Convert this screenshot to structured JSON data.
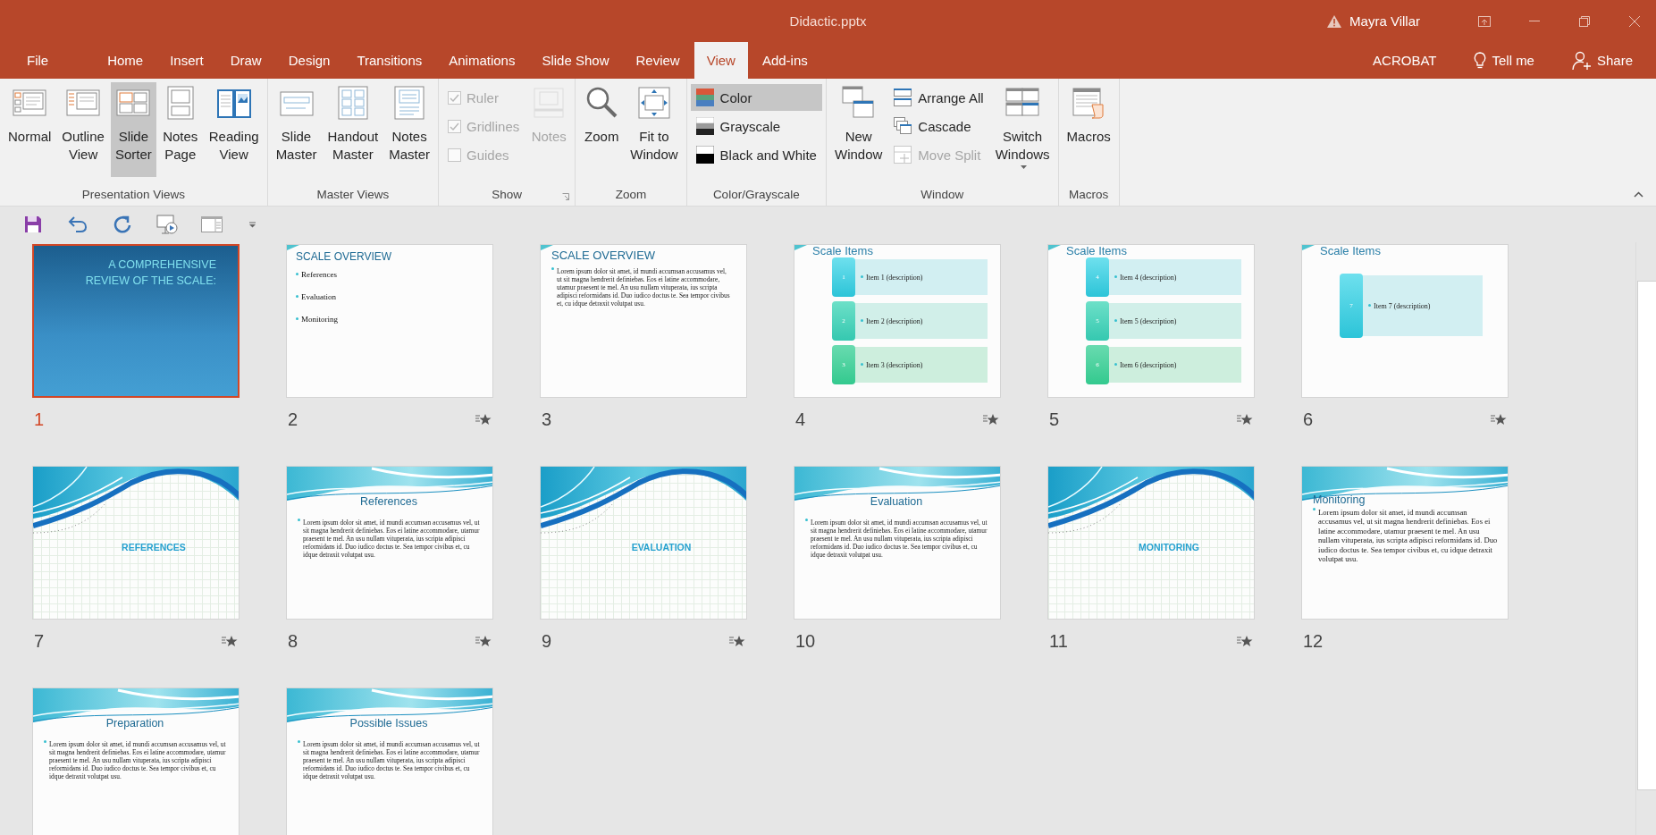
{
  "window": {
    "title": "Didactic.pptx",
    "user": "Mayra Villar"
  },
  "tabs": [
    {
      "label": "File",
      "selected": false
    },
    {
      "label": "Home",
      "selected": false
    },
    {
      "label": "Insert",
      "selected": false
    },
    {
      "label": "Draw",
      "selected": false
    },
    {
      "label": "Design",
      "selected": false
    },
    {
      "label": "Transitions",
      "selected": false
    },
    {
      "label": "Animations",
      "selected": false
    },
    {
      "label": "Slide Show",
      "selected": false
    },
    {
      "label": "Review",
      "selected": false
    },
    {
      "label": "View",
      "selected": true
    },
    {
      "label": "Add-ins",
      "selected": false
    }
  ],
  "right_commands": [
    {
      "kind": "plain",
      "label": "ACROBAT"
    },
    {
      "kind": "tell",
      "label": "Tell me"
    },
    {
      "kind": "share",
      "label": "Share"
    }
  ],
  "ribbon": {
    "groups": [
      {
        "label": "Presentation Views",
        "items": [
          {
            "kind": "large",
            "label": "Normal",
            "selected": false
          },
          {
            "kind": "large",
            "label": "Outline\nView",
            "selected": false
          },
          {
            "kind": "large",
            "label": "Slide\nSorter",
            "selected": true
          },
          {
            "kind": "large",
            "label": "Notes\nPage",
            "selected": false
          },
          {
            "kind": "large",
            "label": "Reading\nView",
            "selected": false
          }
        ]
      },
      {
        "label": "Master Views",
        "items": [
          {
            "kind": "large",
            "label": "Slide\nMaster"
          },
          {
            "kind": "large",
            "label": "Handout\nMaster"
          },
          {
            "kind": "large",
            "label": "Notes\nMaster"
          }
        ]
      },
      {
        "label": "Show",
        "launcher": true,
        "items": [
          {
            "kind": "check",
            "label": "Ruler",
            "checked": true,
            "disabled": true
          },
          {
            "kind": "check",
            "label": "Gridlines",
            "checked": true,
            "disabled": true
          },
          {
            "kind": "check",
            "label": "Guides",
            "checked": false,
            "disabled": true
          },
          {
            "kind": "large",
            "label": "Notes",
            "disabled": true
          }
        ]
      },
      {
        "label": "Zoom",
        "items": [
          {
            "kind": "large",
            "label": "Zoom"
          },
          {
            "kind": "large",
            "label": "Fit to\nWindow"
          }
        ]
      },
      {
        "label": "Color/Grayscale",
        "items": [
          {
            "kind": "small",
            "label": "Color",
            "selected": true
          },
          {
            "kind": "small",
            "label": "Grayscale",
            "selected": false
          },
          {
            "kind": "small",
            "label": "Black and White",
            "selected": false
          }
        ]
      },
      {
        "label": "Window",
        "items": [
          {
            "kind": "large",
            "label": "New\nWindow",
            "disabled": false
          },
          {
            "kind": "small",
            "label": "Arrange All",
            "disabled": false
          },
          {
            "kind": "small",
            "label": "Cascade",
            "disabled": false
          },
          {
            "kind": "small",
            "label": "Move Split",
            "disabled": true
          },
          {
            "kind": "large",
            "label": "Switch\nWindows",
            "dropdown": true,
            "disabled": false
          }
        ]
      },
      {
        "label": "Macros",
        "items": [
          {
            "kind": "large",
            "label": "Macros"
          }
        ]
      }
    ]
  },
  "slides": [
    {
      "number": "1",
      "selected": true,
      "animated": false,
      "kind": "title",
      "lines": [
        "A COMPREHENSIVE",
        "REVIEW OF THE SCALE:"
      ]
    },
    {
      "number": "2",
      "selected": false,
      "animated": true,
      "kind": "bullets",
      "title": "SCALE OVERVIEW",
      "bullets": [
        "References",
        "Evaluation",
        "Monitoring"
      ]
    },
    {
      "number": "3",
      "selected": false,
      "animated": false,
      "kind": "text",
      "title": "SCALE OVERVIEW",
      "body": "Lorem ipsum dolor sit amet, id mundi accumsan accusamus vel, ut sit magna hendrerit definiebas. Eos ei latine accommodare, utamur praesent te mel. An usu nullam vituperata, ius scripta adipisci reformidans id. Duo iudico doctus te. Sea tempor civibus et, cu idque detraxit volutpat usu."
    },
    {
      "number": "4",
      "selected": false,
      "animated": true,
      "kind": "items",
      "title": "Scale Items",
      "items": [
        {
          "num": "1",
          "label": "Item 1 (description)"
        },
        {
          "num": "2",
          "label": "Item 2 (description)"
        },
        {
          "num": "3",
          "label": "Item 3 (description)"
        }
      ]
    },
    {
      "number": "5",
      "selected": false,
      "animated": true,
      "kind": "items",
      "title": "Scale Items",
      "items": [
        {
          "num": "4",
          "label": "Item 4 (description)"
        },
        {
          "num": "5",
          "label": "Item 5 (description)"
        },
        {
          "num": "6",
          "label": "Item 6 (description)"
        }
      ]
    },
    {
      "number": "6",
      "selected": false,
      "animated": true,
      "kind": "items",
      "title": "Scale Items",
      "items": [
        {
          "num": "7",
          "label": "Item 7 (description)"
        }
      ]
    },
    {
      "number": "7",
      "selected": false,
      "animated": true,
      "kind": "section",
      "title": "REFERENCES"
    },
    {
      "number": "8",
      "selected": false,
      "animated": true,
      "kind": "wave_text",
      "title": "References",
      "body": "Lorem ipsum dolor sit amet, id mundi accumsan accusamus vel, ut sit magna hendrerit definiebas. Eos ei latine accommodare, utamur praesent te mel. An usu nullam vituperata, ius scripta adipisci reformidans id. Duo iudico doctus te. Sea tempor civibus et, cu idque detraxit volutpat usu."
    },
    {
      "number": "9",
      "selected": false,
      "animated": true,
      "kind": "section",
      "title": "EVALUATION"
    },
    {
      "number": "10",
      "selected": false,
      "animated": false,
      "kind": "wave_text",
      "title": "Evaluation",
      "body": "Lorem ipsum dolor sit amet, id mundi accumsan accusamus vel, ut sit magna hendrerit definiebas. Eos ei latine accommodare, utamur praesent te mel. An usu nullam vituperata, ius scripta adipisci reformidans id. Duo iudico doctus te. Sea tempor civibus et, cu idque detraxit volutpat usu."
    },
    {
      "number": "11",
      "selected": false,
      "animated": true,
      "kind": "section",
      "title": "MONITORING"
    },
    {
      "number": "12",
      "selected": false,
      "animated": false,
      "kind": "wave_text_left",
      "title": "Monitoring",
      "body": "Lorem ipsum dolor sit amet, id mundi accumsan accusamus vel, ut sit magna hendrerit definiebas. Eos ei latine accommodare, utamur praesent te mel. An usu nullam vituperata, ius scripta adipisci reformidans id. Duo iudico doctus te. Sea tempor civibus et, cu idque detraxit volutpat usu."
    },
    {
      "selected": false,
      "kind": "wave_text",
      "title": "Preparation",
      "body": "Lorem ipsum dolor sit amet, id mundi accumsan accusamus vel, ut sit magna hendrerit definiebas. Eos ei latine accommodare, utamur praesent te mel. An usu nullam vituperata, ius scripta adipisci reformidans id. Duo iudico doctus te. Sea tempor civibus et, cu idque detraxit volutpat usu."
    },
    {
      "selected": false,
      "kind": "wave_text",
      "title": "Possible Issues",
      "body": "Lorem ipsum dolor sit amet, id mundi accumsan accusamus vel, ut sit magna hendrerit definiebas. Eos ei latine accommodare, utamur praesent te mel. An usu nullam vituperata, ius scripta adipisci reformidans id. Duo iudico doctus te. Sea tempor civibus et, cu idque detraxit volutpat usu."
    }
  ]
}
